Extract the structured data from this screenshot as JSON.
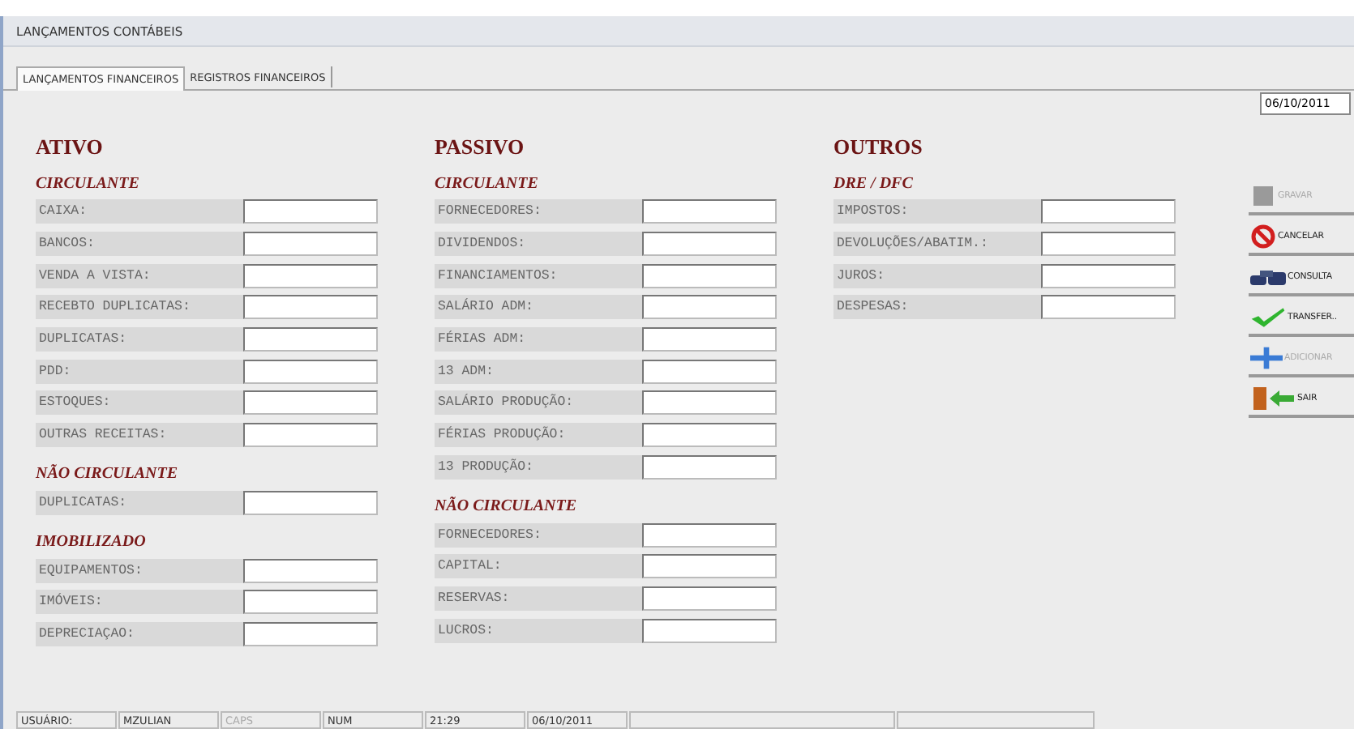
{
  "window": {
    "title": "LANÇAMENTOS CONTÁBEIS"
  },
  "tabs": [
    {
      "label": "LANÇAMENTOS FINANCEIROS",
      "selected": true
    },
    {
      "label": "REGISTROS FINANCEIROS",
      "selected": false
    }
  ],
  "date_field": {
    "value": "06/10/2011"
  },
  "columns": [
    {
      "title": "ATIVO",
      "groups": [
        {
          "title": "CIRCULANTE",
          "fields": [
            "CAIXA:",
            "BANCOS:",
            "VENDA A VISTA:",
            "RECEBTO DUPLICATAS:",
            "DUPLICATAS:",
            "PDD:",
            "ESTOQUES:",
            "OUTRAS RECEITAS:"
          ]
        },
        {
          "title": "NÃO CIRCULANTE",
          "fields": [
            "DUPLICATAS:"
          ]
        },
        {
          "title": "IMOBILIZADO",
          "fields": [
            "EQUIPAMENTOS:",
            "IMÓVEIS:",
            "DEPRECIAÇAO:"
          ]
        }
      ]
    },
    {
      "title": "PASSIVO",
      "groups": [
        {
          "title": "CIRCULANTE",
          "fields": [
            "FORNECEDORES:",
            "DIVIDENDOS:",
            "FINANCIAMENTOS:",
            "SALÁRIO ADM:",
            "FÉRIAS ADM:",
            "13 ADM:",
            "SALÁRIO PRODUÇÃO:",
            "FÉRIAS PRODUÇÃO:",
            "13 PRODUÇÃO:"
          ]
        },
        {
          "title": "NÃO CIRCULANTE",
          "fields": [
            "FORNECEDORES:",
            "CAPITAL:",
            "RESERVAS:",
            "LUCROS:"
          ]
        }
      ]
    },
    {
      "title": "OUTROS",
      "groups": [
        {
          "title": "DRE / DFC",
          "fields": [
            "IMPOSTOS:",
            "DEVOLUÇÕES/ABATIM.:",
            "JUROS:",
            "DESPESAS:"
          ]
        }
      ]
    }
  ],
  "buttons": [
    {
      "kind": "save",
      "label": "GRAVAR",
      "disabled": true
    },
    {
      "kind": "cancel",
      "label": "CANCELAR",
      "disabled": false
    },
    {
      "kind": "query",
      "label": "CONSULTA",
      "disabled": false
    },
    {
      "kind": "transfer",
      "label": "TRANSFER..",
      "disabled": false
    },
    {
      "kind": "add",
      "label": "ADICIONAR",
      "disabled": true
    },
    {
      "kind": "exit",
      "label": "SAIR",
      "disabled": false
    }
  ],
  "status_bar": [
    {
      "text": "USUÁRIO:",
      "disabled": false
    },
    {
      "text": "MZULIAN",
      "disabled": false
    },
    {
      "text": "CAPS",
      "disabled": true
    },
    {
      "text": "NUM",
      "disabled": false
    },
    {
      "text": "21:29",
      "disabled": false
    },
    {
      "text": "06/10/2011",
      "disabled": false
    }
  ]
}
